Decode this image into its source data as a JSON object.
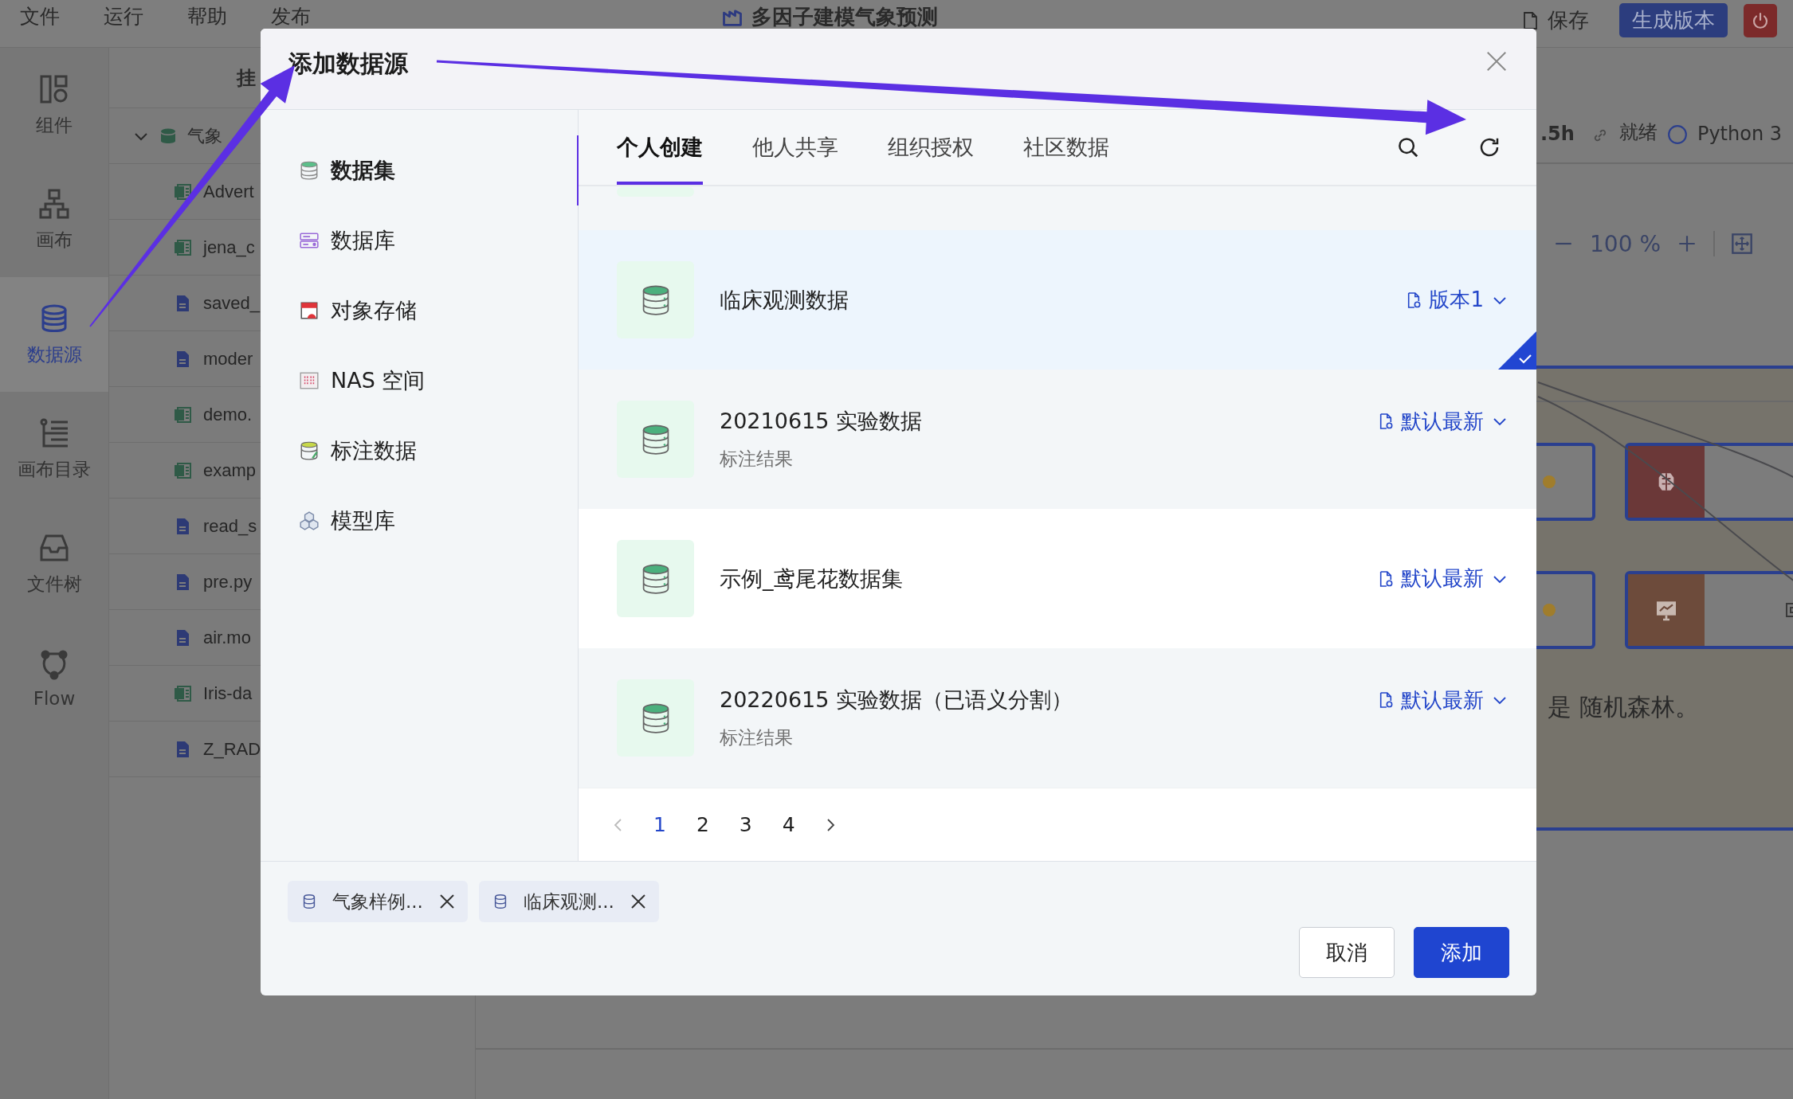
{
  "menubar": {
    "items": [
      "文件",
      "运行",
      "帮助",
      "发布"
    ],
    "title": "多因子建模气象预测",
    "save": "保存",
    "generate": "生成版本"
  },
  "nav": [
    {
      "label": "组件",
      "selected": false
    },
    {
      "label": "画布",
      "selected": false
    },
    {
      "label": "数据源",
      "selected": true
    },
    {
      "label": "画布目录",
      "selected": false
    },
    {
      "label": "文件树",
      "selected": false
    },
    {
      "label": "Flow",
      "selected": false
    }
  ],
  "file_panel": {
    "header": "挂",
    "root": {
      "label": "气象",
      "expanded": true
    },
    "files": [
      {
        "name": "Advert",
        "kind": "csv"
      },
      {
        "name": "jena_c",
        "kind": "csv"
      },
      {
        "name": "saved_",
        "kind": "doc"
      },
      {
        "name": "moder",
        "kind": "doc"
      },
      {
        "name": "demo.",
        "kind": "csv"
      },
      {
        "name": "examp",
        "kind": "csv"
      },
      {
        "name": "read_s",
        "kind": "doc"
      },
      {
        "name": "pre.py",
        "kind": "doc"
      },
      {
        "name": "air.mo",
        "kind": "doc"
      },
      {
        "name": "Iris-da",
        "kind": "csv"
      },
      {
        "name": "Z_RAD",
        "kind": "doc"
      }
    ]
  },
  "status": {
    "time": ".5h",
    "state": "就绪",
    "kernel": "Python 3"
  },
  "zoom": {
    "value": "100 %"
  },
  "canvas": {
    "text": "是 随机森林。"
  },
  "dialog": {
    "title": "添加数据源",
    "sources": [
      {
        "label": "数据集",
        "selected": true
      },
      {
        "label": "数据库",
        "selected": false
      },
      {
        "label": "对象存储",
        "selected": false
      },
      {
        "label": "NAS 空间",
        "selected": false
      },
      {
        "label": "标注数据",
        "selected": false
      },
      {
        "label": "模型库",
        "selected": false
      }
    ],
    "tabs": [
      {
        "label": "个人创建",
        "selected": true
      },
      {
        "label": "他人共享",
        "selected": false
      },
      {
        "label": "组织授权",
        "selected": false
      },
      {
        "label": "社区数据",
        "selected": false
      }
    ],
    "datasets": [
      {
        "title": "临床观测数据",
        "version": "版本1",
        "selected": true
      },
      {
        "title": "20210615 实验数据",
        "subtitle": "标注结果",
        "version": "默认最新",
        "selected": false
      },
      {
        "title": "示例_鸢尾花数据集",
        "version": "默认最新",
        "selected": false
      },
      {
        "title": "20220615 实验数据（已语义分割）",
        "subtitle": "标注结果",
        "version": "默认最新",
        "selected": false
      }
    ],
    "pages": [
      {
        "label": "1",
        "selected": true
      },
      {
        "label": "2",
        "selected": false
      },
      {
        "label": "3",
        "selected": false
      },
      {
        "label": "4",
        "selected": false
      }
    ],
    "chosen": [
      {
        "label": "气象样例..."
      },
      {
        "label": "临床观测..."
      }
    ],
    "cancel": "取消",
    "confirm": "添加"
  }
}
